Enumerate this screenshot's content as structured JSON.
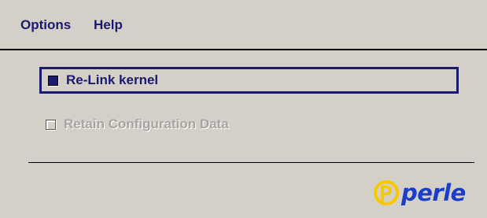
{
  "menubar": {
    "items": [
      "Options",
      "Help"
    ]
  },
  "options": [
    {
      "label": "Re-Link kernel",
      "checked": true,
      "enabled": true,
      "focused": true
    },
    {
      "label": "Retain Configuration Data",
      "checked": false,
      "enabled": false,
      "focused": false
    }
  ],
  "logo": {
    "text": "perle",
    "icon": "perle-logo-icon",
    "colors": {
      "brand_blue": "#1a3ec8",
      "brand_yellow": "#f5c800"
    }
  },
  "colors": {
    "background": "#d4d0c8",
    "accent": "#1a1a6e",
    "disabled_text": "#a8a4a0"
  }
}
